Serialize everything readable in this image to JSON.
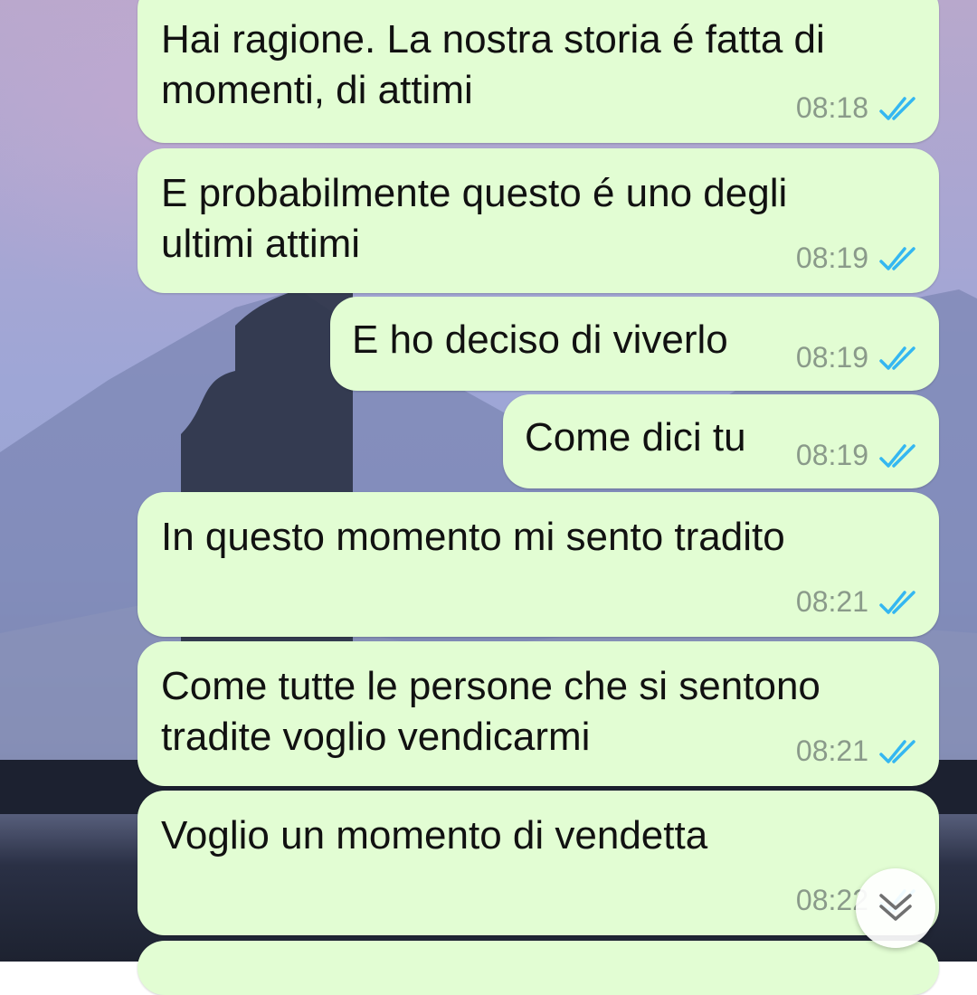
{
  "colors": {
    "bubble_out": "#e2fdd3",
    "read_ticks": "#34b7f1",
    "time": "#8a9a8a"
  },
  "messages": [
    {
      "text": "Hai ragione. La nostra storia é fatta di\nmomenti, di attimi",
      "time": "08:18",
      "status": "read"
    },
    {
      "text": "E probabilmente questo é uno degli\nultimi attimi",
      "time": "08:19",
      "status": "read"
    },
    {
      "text": "E ho deciso di viverlo",
      "time": "08:19",
      "status": "read"
    },
    {
      "text": "Come dici tu",
      "time": "08:19",
      "status": "read"
    },
    {
      "text": "In questo momento mi sento tradito",
      "time": "08:21",
      "status": "read"
    },
    {
      "text": "Come tutte le persone che si sentono\ntradite voglio vendicarmi",
      "time": "08:21",
      "status": "read"
    },
    {
      "text": "Voglio un momento di vendetta",
      "time": "08:22",
      "status": "read"
    }
  ],
  "scroll_button": {
    "icon": "chevron-down-double-icon"
  }
}
